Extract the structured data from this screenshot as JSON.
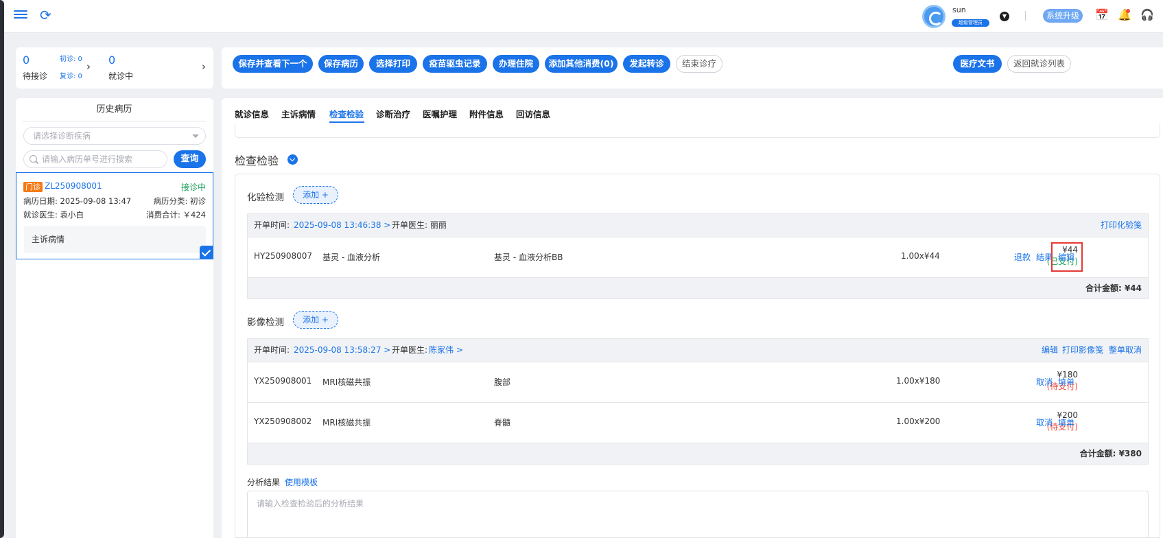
{
  "topbar": {
    "user_name": "sun",
    "user_role": "超级管理员",
    "upgrade_label": "系统升级"
  },
  "queue": {
    "waiting_count": "0",
    "waiting_label": "待接诊",
    "first_visit": "初诊: 0",
    "return_visit": "复诊: 0",
    "in_progress_count": "0",
    "in_progress_label": "就诊中"
  },
  "history": {
    "title": "历史病历",
    "disease_placeholder": "请选择诊断疾病",
    "search_placeholder": "请输入病历单号进行搜索",
    "query_label": "查询",
    "record": {
      "tag": "门诊",
      "id": "ZL250908001",
      "status": "接诊中",
      "date": "病历日期: 2025-09-08 13:47",
      "category": "病历分类: 初诊",
      "doctor": "就诊医生: 袁小白",
      "total": "消费合计: ￥424",
      "complaint": "主诉病情"
    }
  },
  "toolbar": {
    "buttons": [
      "保存并查看下一个",
      "保存病历",
      "选择打印",
      "疫苗驱虫记录",
      "办理住院",
      "添加其他消费(0)",
      "发起转诊"
    ],
    "end_label": "结束诊疗",
    "medical_doc_label": "医疗文书",
    "back_label": "返回就诊列表"
  },
  "tabs": [
    "就诊信息",
    "主诉病情",
    "检查检验",
    "诊断治疗",
    "医嘱护理",
    "附件信息",
    "回访信息"
  ],
  "section": {
    "title": "检查检验",
    "add_label": "添加 +",
    "lab": {
      "title": "化验检测",
      "time_label": "开单时间:",
      "time": "2025-09-08 13:46:38 >",
      "doctor_label": "开单医生: 丽丽",
      "print_label": "打印化验笺",
      "rows": [
        {
          "id": "HY250908007",
          "name": "基灵 - 血液分析",
          "detail": "基灵 - 血液分析BB",
          "qty": "1.00x¥44",
          "price": "¥44",
          "status": "(已支付)",
          "actions": [
            "退款",
            "结果",
            "编辑"
          ]
        }
      ],
      "total": "合计金额: ¥44"
    },
    "imaging": {
      "title": "影像检测",
      "time_label": "开单时间:",
      "time": "2025-09-08 13:58:27 >",
      "doctor_label": "开单医生:",
      "doctor": "陈家伟 >",
      "edit_label": "编辑",
      "print_label": "打印影像笺",
      "cancel_all_label": "整单取消",
      "rows": [
        {
          "id": "YX250908001",
          "name": "MRI核磁共振",
          "detail": "腹部",
          "qty": "1.00x¥180",
          "price": "¥180",
          "status": "(待支付)",
          "actions": [
            "取消",
            "填单"
          ]
        },
        {
          "id": "YX250908002",
          "name": "MRI核磁共振",
          "detail": "脊髓",
          "qty": "1.00x¥200",
          "price": "¥200",
          "status": "(待支付)",
          "actions": [
            "取消",
            "填单"
          ]
        }
      ],
      "total": "合计金额: ¥380"
    },
    "analysis_label": "分析结果",
    "template_label": "使用模板",
    "analysis_placeholder": "请输入检查检验后的分析结果"
  }
}
